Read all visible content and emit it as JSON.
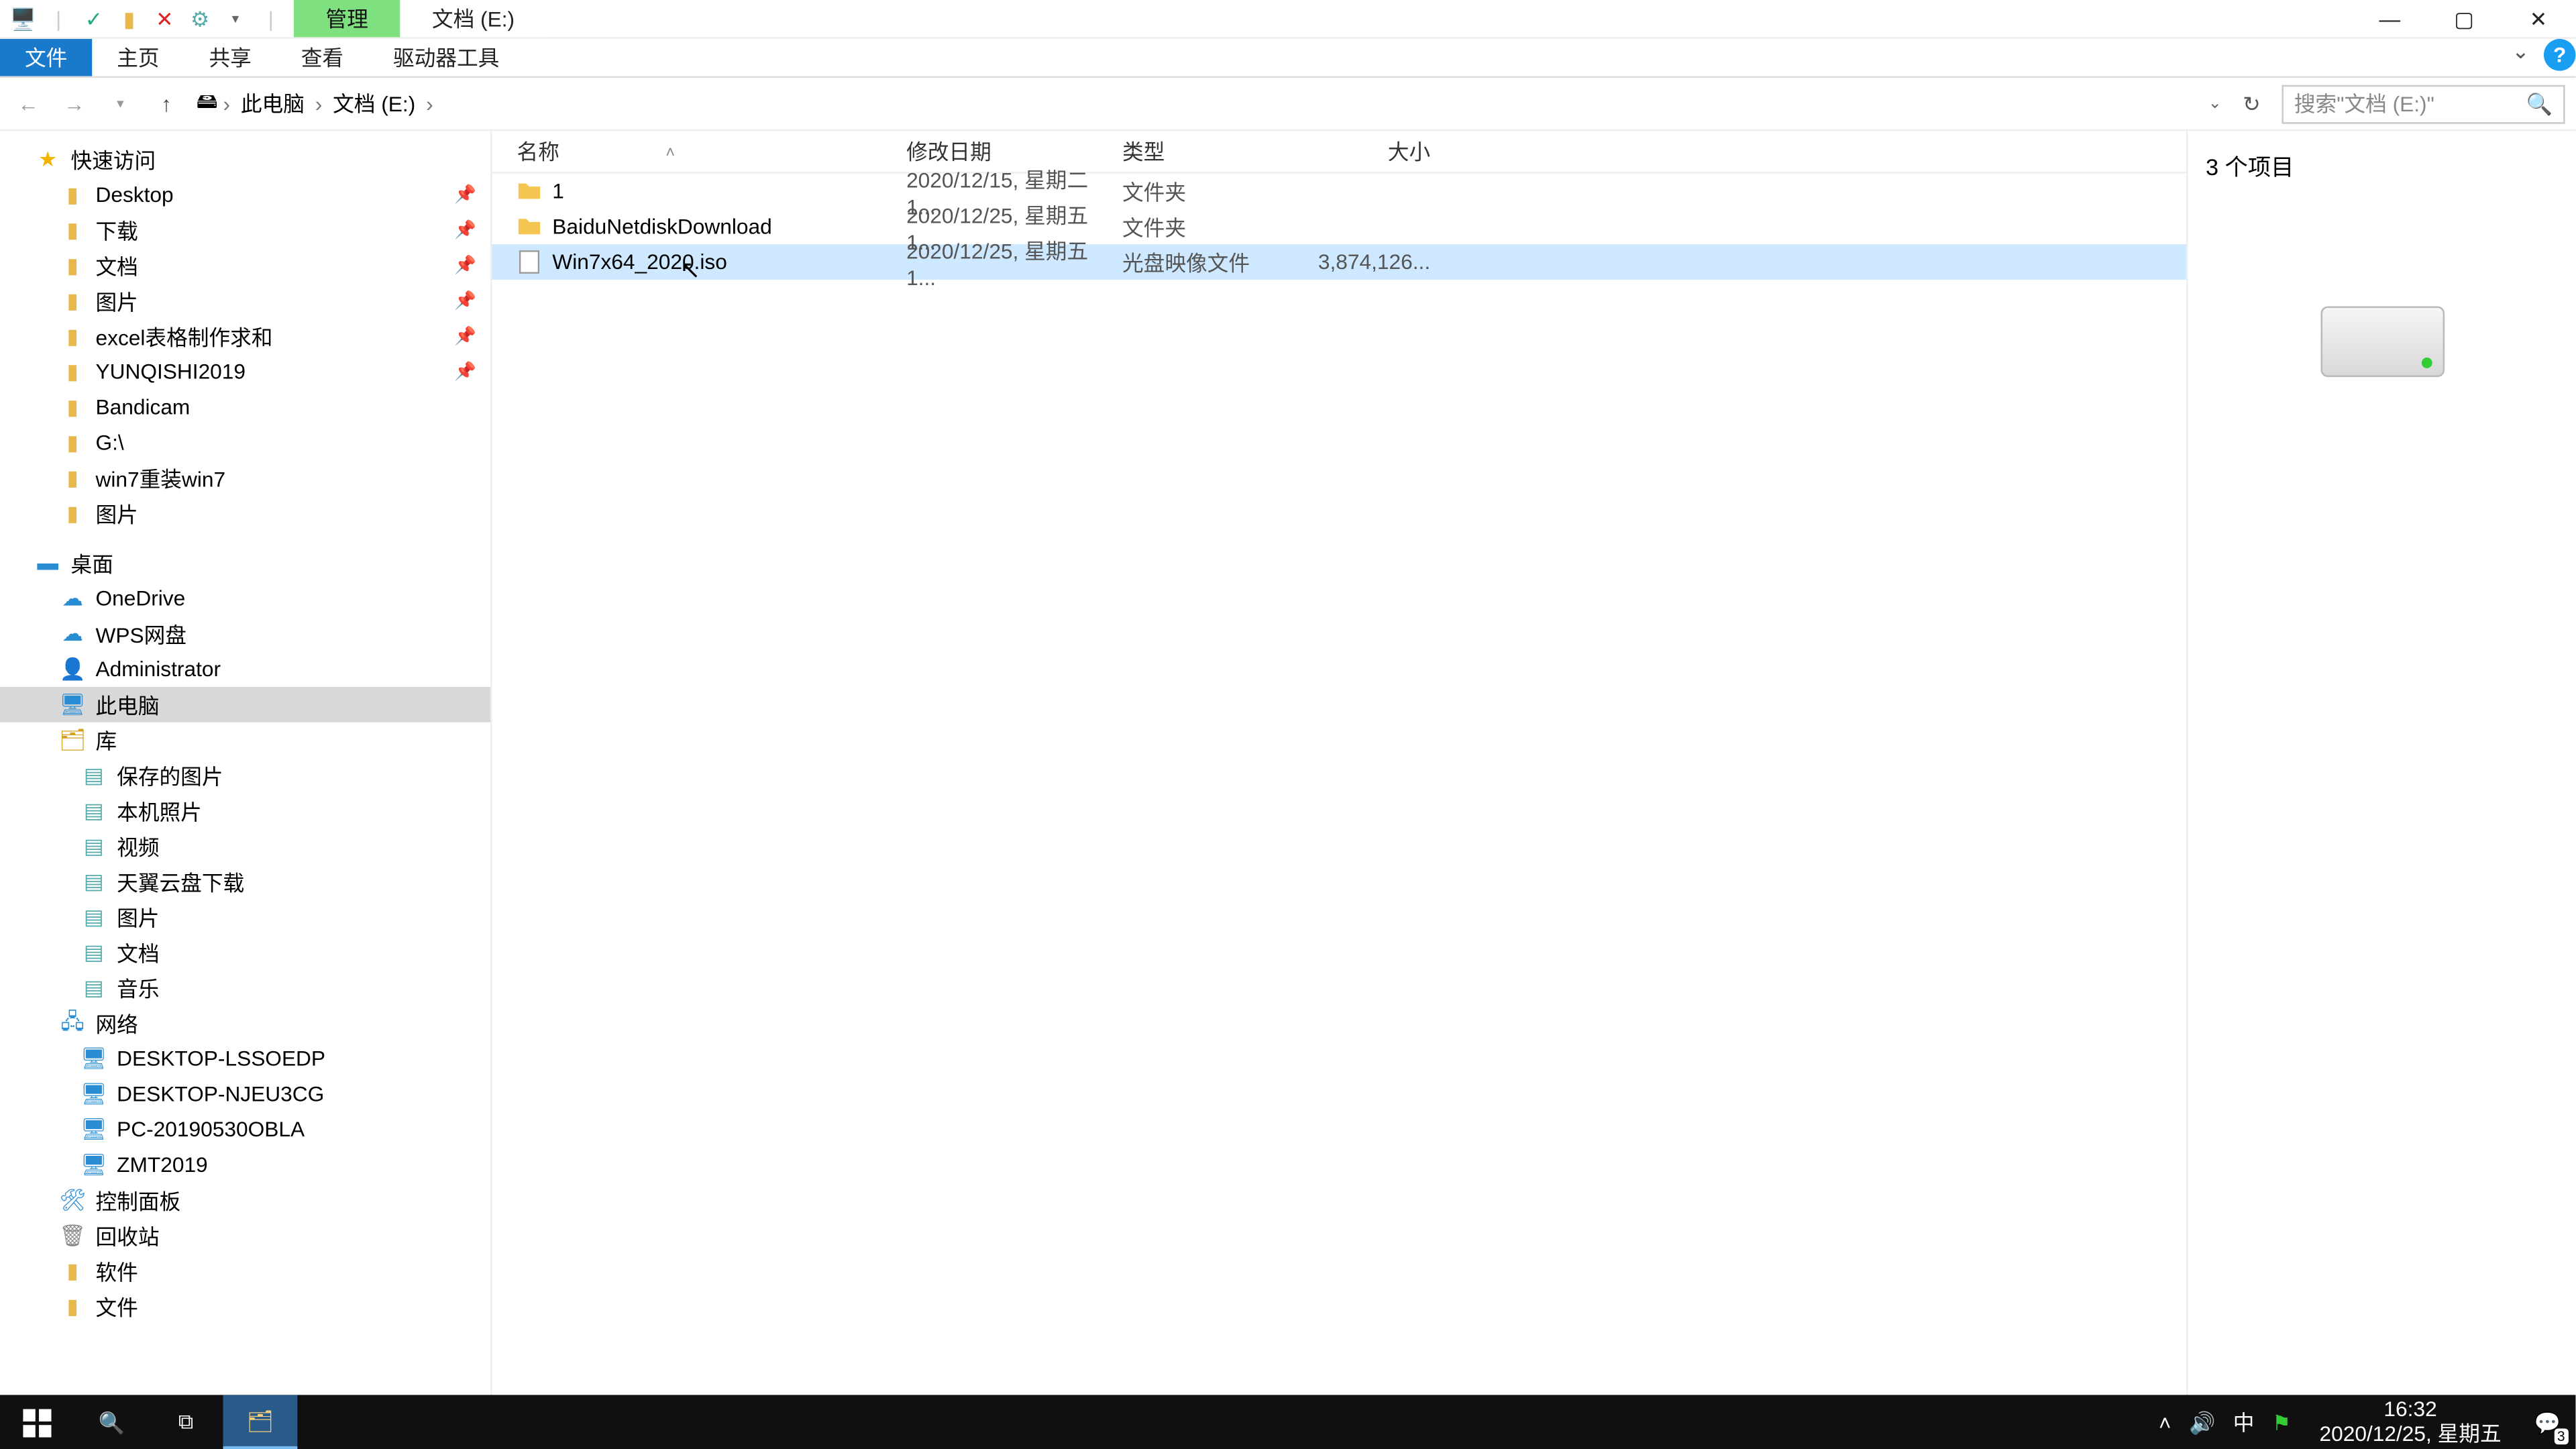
{
  "titlebar": {
    "contextual_tab": "管理",
    "window_title": "文档 (E:)"
  },
  "ribbon": {
    "file": "文件",
    "home": "主页",
    "share": "共享",
    "view": "查看",
    "drive_tools": "驱动器工具"
  },
  "breadcrumb": {
    "this_pc": "此电脑",
    "location": "文档 (E:)"
  },
  "search": {
    "placeholder": "搜索\"文档 (E:)\""
  },
  "columns": {
    "name": "名称",
    "date": "修改日期",
    "type": "类型",
    "size": "大小"
  },
  "files": [
    {
      "name": "1",
      "date": "2020/12/15, 星期二 1...",
      "type": "文件夹",
      "size": "",
      "icon": "folder"
    },
    {
      "name": "BaiduNetdiskDownload",
      "date": "2020/12/25, 星期五 1...",
      "type": "文件夹",
      "size": "",
      "icon": "folder"
    },
    {
      "name": "Win7x64_2020.iso",
      "date": "2020/12/25, 星期五 1...",
      "type": "光盘映像文件",
      "size": "3,874,126...",
      "icon": "iso",
      "selected": true
    }
  ],
  "nav": {
    "quick_access": "快速访问",
    "items_qa": [
      {
        "label": "Desktop",
        "icon": "desktop",
        "pin": true
      },
      {
        "label": "下载",
        "icon": "download",
        "pin": true
      },
      {
        "label": "文档",
        "icon": "doc",
        "pin": true
      },
      {
        "label": "图片",
        "icon": "pic",
        "pin": true
      },
      {
        "label": "excel表格制作求和",
        "icon": "folder",
        "pin": true
      },
      {
        "label": "YUNQISHI2019",
        "icon": "folder",
        "pin": true
      },
      {
        "label": "Bandicam",
        "icon": "folder"
      },
      {
        "label": "G:\\",
        "icon": "drive"
      },
      {
        "label": "win7重装win7",
        "icon": "folder"
      },
      {
        "label": "图片",
        "icon": "folder"
      }
    ],
    "desktop": "桌面",
    "onedrive": "OneDrive",
    "wps": "WPS网盘",
    "admin": "Administrator",
    "this_pc": "此电脑",
    "libraries": "库",
    "lib_items": [
      {
        "label": "保存的图片"
      },
      {
        "label": "本机照片"
      },
      {
        "label": "视频"
      },
      {
        "label": "天翼云盘下载"
      },
      {
        "label": "图片"
      },
      {
        "label": "文档"
      },
      {
        "label": "音乐"
      }
    ],
    "network": "网络",
    "net_items": [
      {
        "label": "DESKTOP-LSSOEDP"
      },
      {
        "label": "DESKTOP-NJEU3CG"
      },
      {
        "label": "PC-20190530OBLA"
      },
      {
        "label": "ZMT2019"
      }
    ],
    "control_panel": "控制面板",
    "recycle": "回收站",
    "software": "软件",
    "documents": "文件"
  },
  "preview": {
    "count": "3 个项目"
  },
  "statusbar": {
    "text": "3 个项目"
  },
  "taskbar": {
    "time": "16:32",
    "date": "2020/12/25, 星期五",
    "ime": "中",
    "notif_count": "3"
  }
}
